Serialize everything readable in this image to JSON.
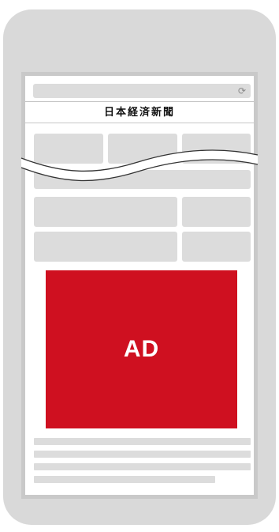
{
  "browser": {
    "reload_icon": "⟳"
  },
  "masthead": {
    "title": "日本経済新聞"
  },
  "ad": {
    "label": "AD",
    "color": "#cf1020"
  },
  "icons": [
    "reload-icon"
  ]
}
